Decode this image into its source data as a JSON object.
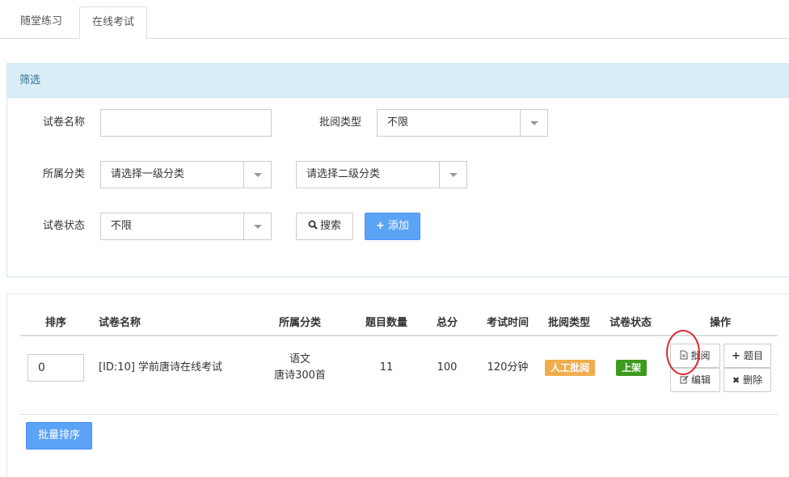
{
  "tabs": [
    {
      "label": "随堂练习"
    },
    {
      "label": "在线考试"
    }
  ],
  "filter": {
    "heading": "筛选",
    "paper_name_label": "试卷名称",
    "paper_name_value": "",
    "review_type_label": "批阅类型",
    "review_type_value": "不限",
    "category_label": "所属分类",
    "category1_value": "请选择一级分类",
    "category2_value": "请选择二级分类",
    "status_label": "试卷状态",
    "status_value": "不限",
    "search_label": "搜索",
    "add_label": "添加"
  },
  "table": {
    "headers": [
      "排序",
      "试卷名称",
      "所属分类",
      "题目数量",
      "总分",
      "考试时间",
      "批阅类型",
      "试卷状态",
      "操作"
    ],
    "rows": [
      {
        "sort": "0",
        "name": "[ID:10] 学前唐诗在线考试",
        "category_line1": "语文",
        "category_line2": "唐诗300首",
        "question_count": "11",
        "total_score": "100",
        "exam_time": "120分钟",
        "review_type": "人工批阅",
        "status": "上架",
        "actions": {
          "review": "批阅",
          "questions": "题目",
          "edit": "编辑",
          "delete": "删除"
        }
      }
    ],
    "batch_sort_label": "批量排序"
  },
  "colors": {
    "review_badge": "#f0ad4e",
    "status_badge": "#3c9a1e",
    "primary": "#5ba3f5",
    "highlight_circle": "#e0282e"
  }
}
